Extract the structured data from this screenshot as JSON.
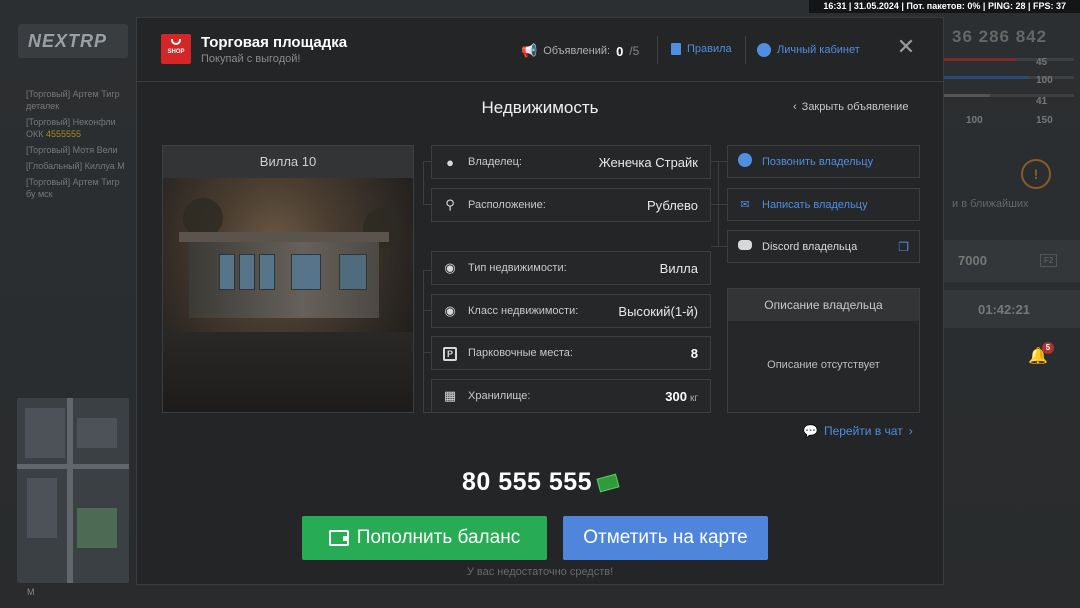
{
  "status_bar": "16:31 | 31.05.2024 | Пот. пакетов: 0% | PING: 28 | FPS: 37",
  "background": {
    "logo": "NEXTRP",
    "money": "36 286 842",
    "stats": {
      "s1": "45",
      "s2": "100",
      "s3": "41",
      "s4": "100",
      "s5": "150"
    },
    "side_text": "и в ближайших",
    "balance": "7000",
    "key_hint": "F2",
    "timer": "01:42:21",
    "notif_count": "5",
    "map_label": "M",
    "chat": [
      {
        "text": "[Торговый] Артем Тигр",
        "extra": ""
      },
      {
        "text": "деталек",
        "extra": ""
      },
      {
        "text": "[Торговый] Неконфли",
        "extra": ""
      },
      {
        "text": "ОКК ",
        "extra": "4555555"
      },
      {
        "text": "[Торговый] Мотя Вели",
        "extra": ""
      },
      {
        "text": "[Глобальный] Киллуа М",
        "extra": ""
      },
      {
        "text": "[Торговый] Артем Тигр",
        "extra": ""
      },
      {
        "text": "бу мск",
        "extra": ""
      }
    ]
  },
  "header": {
    "shop_badge": "SHOP",
    "title": "Торговая площадка",
    "subtitle": "Покупай с выгодой!",
    "ads_label": "Объявлений:",
    "ads_count": "0",
    "ads_max": "/5",
    "rules_label": "Правила",
    "account_label": "Личный кабинет"
  },
  "section_title": "Недвижимость",
  "close_ad_label": "Закрыть объявление",
  "property": {
    "name": "Вилла 10"
  },
  "info_rows": [
    {
      "icon": "user-icon",
      "label": "Владелец:",
      "value": "Женечка Страйк"
    },
    {
      "icon": "location-pin-icon",
      "label": "Расположение:",
      "value": "Рублево"
    },
    {
      "icon": "money-bag-icon",
      "label": "Тип недвижимости:",
      "value": "Вилла"
    },
    {
      "icon": "money-bag-icon",
      "label": "Класс недвижимости:",
      "value": "Высокий(1-й)"
    },
    {
      "icon": "parking-icon",
      "label": "Парковочные места:",
      "value": "8"
    },
    {
      "icon": "boxes-icon",
      "label": "Хранилище:",
      "value": "300",
      "unit": "кг"
    }
  ],
  "actions": {
    "call": "Позвонить владельцу",
    "message": "Написать владельцу",
    "discord": "Discord владельца"
  },
  "description": {
    "title": "Описание владельца",
    "body": "Описание отсутствует"
  },
  "go_chat": "Перейти в чат",
  "price": "80 555 555",
  "buttons": {
    "topup": "Пополнить баланс",
    "map": "Отметить на карте"
  },
  "warning": "У вас недостаточно средств!",
  "colors": {
    "accent_blue": "#4f8ee0",
    "green": "#27ab55",
    "blue_button": "#4f86dc",
    "shop_red": "#d32626"
  }
}
